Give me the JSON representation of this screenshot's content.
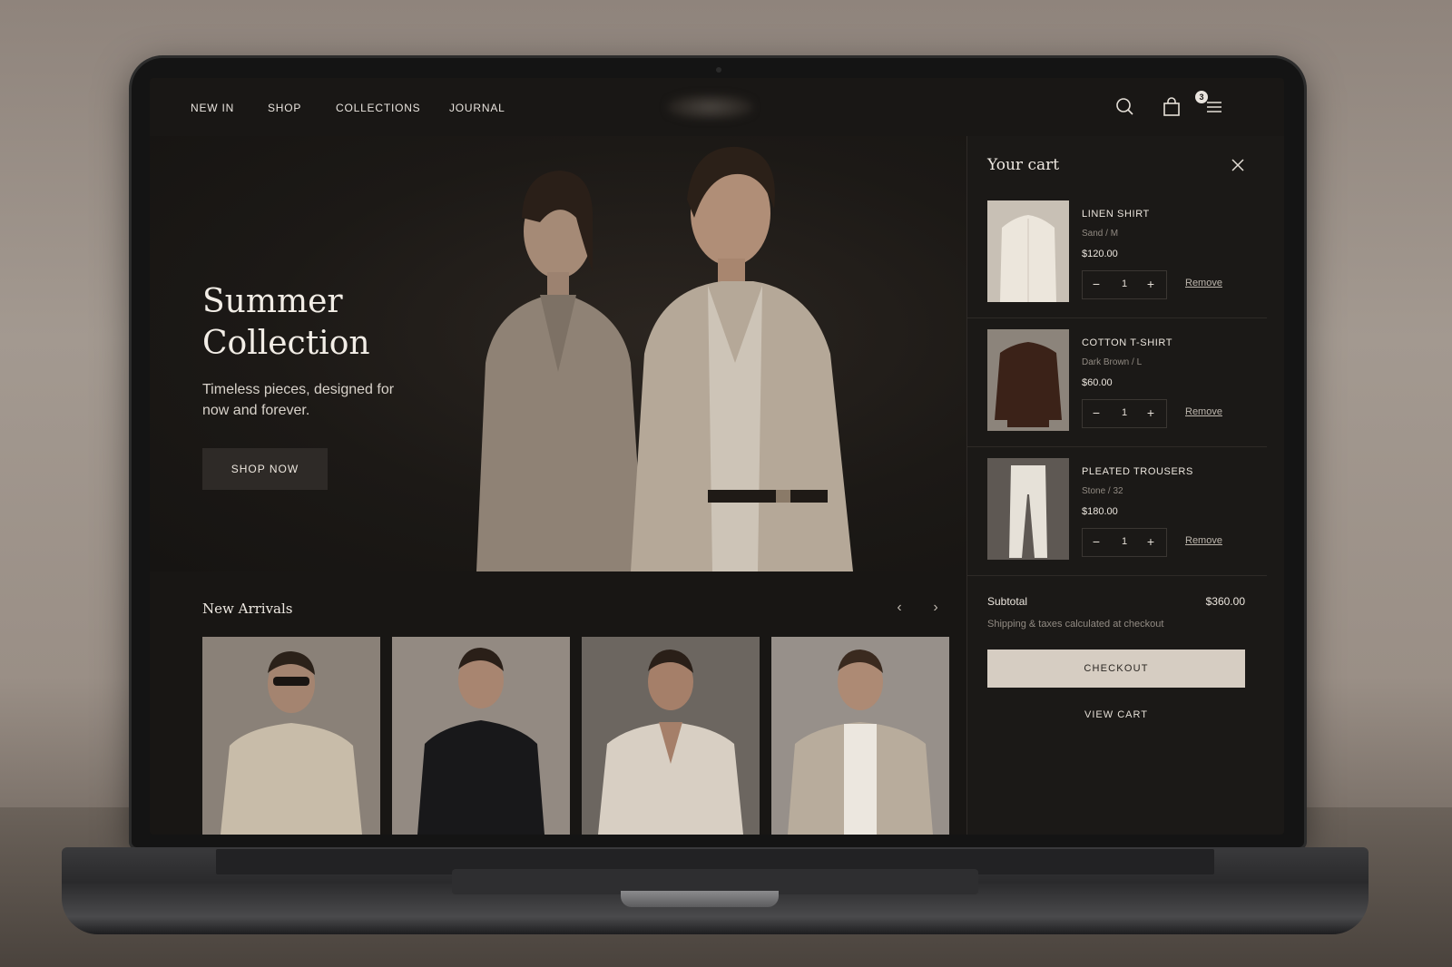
{
  "nav": {
    "links": [
      "NEW IN",
      "SHOP",
      "COLLECTIONS",
      "JOURNAL"
    ],
    "cart_count": "3",
    "icons": [
      "search-icon",
      "shopping-bag-icon",
      "menu-icon"
    ]
  },
  "hero": {
    "title": "Summer\nCollection",
    "subtitle": "Timeless pieces, designed for now and forever.",
    "cta": "SHOP NOW"
  },
  "arrivals": {
    "title": "New Arrivals"
  },
  "cart": {
    "title": "Your cart",
    "items": [
      {
        "name": "LINEN SHIRT",
        "variant": "Sand / M",
        "price": "$120.00",
        "qty": "1",
        "remove": "Remove"
      },
      {
        "name": "COTTON T-SHIRT",
        "variant": "Dark Brown / L",
        "price": "$60.00",
        "qty": "1",
        "remove": "Remove"
      },
      {
        "name": "PLEATED TROUSERS",
        "variant": "Stone / 32",
        "price": "$180.00",
        "qty": "1",
        "remove": "Remove"
      }
    ],
    "subtotal_label": "Subtotal",
    "subtotal_value": "$360.00",
    "shipping_note": "Shipping & taxes calculated at checkout",
    "checkout": "CHECKOUT",
    "view_cart": "VIEW CART"
  },
  "colors": {
    "background": "#1a1816",
    "text": "#ece6de",
    "checkout_button": "#d6cdc2",
    "muted": "#918a82"
  }
}
